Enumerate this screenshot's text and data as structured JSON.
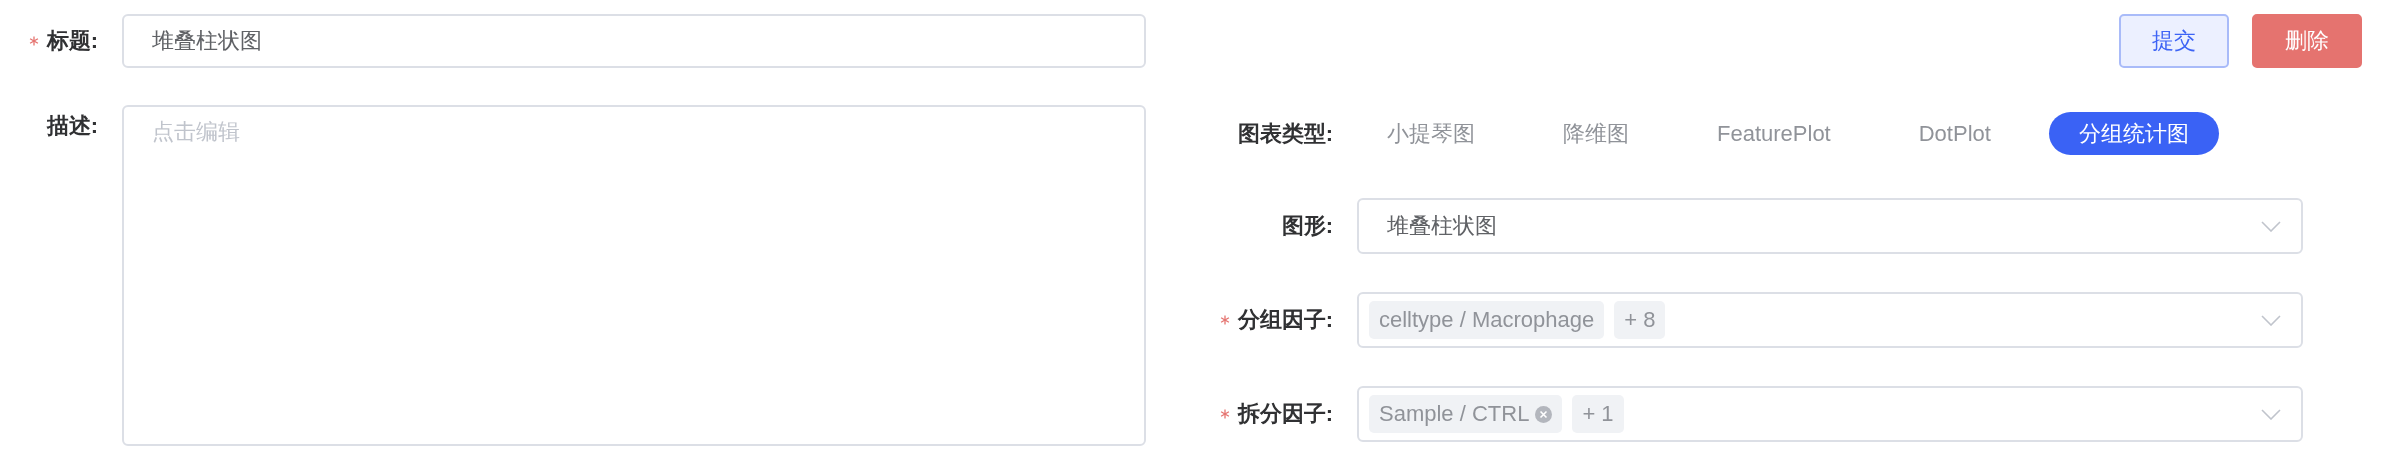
{
  "title_field": {
    "label": "标题:",
    "required": true,
    "value": "堆叠柱状图"
  },
  "description_field": {
    "label": "描述:",
    "required": false,
    "placeholder": "点击编辑"
  },
  "buttons": [
    {
      "label": "提交",
      "kind": "primary"
    },
    {
      "label": "删除",
      "kind": "danger"
    }
  ],
  "chart_type": {
    "label": "图表类型:",
    "tabs": [
      {
        "label": "小提琴图",
        "selected": false
      },
      {
        "label": "降维图",
        "selected": false
      },
      {
        "label": "FeaturePlot",
        "selected": false
      },
      {
        "label": "DotPlot",
        "selected": false
      },
      {
        "label": "分组统计图",
        "selected": true
      }
    ]
  },
  "selects": [
    {
      "label": "图形:",
      "required": false,
      "value": "堆叠柱状图"
    },
    {
      "label": "分组因子:",
      "required": true,
      "tags": [
        {
          "text": "celltype / Macrophage",
          "closable": false
        },
        {
          "text": "+ 8",
          "closable": false
        }
      ]
    },
    {
      "label": "拆分因子:",
      "required": true,
      "tags": [
        {
          "text": "Sample / CTRL",
          "closable": true
        },
        {
          "text": "+ 1",
          "closable": false
        }
      ]
    }
  ]
}
